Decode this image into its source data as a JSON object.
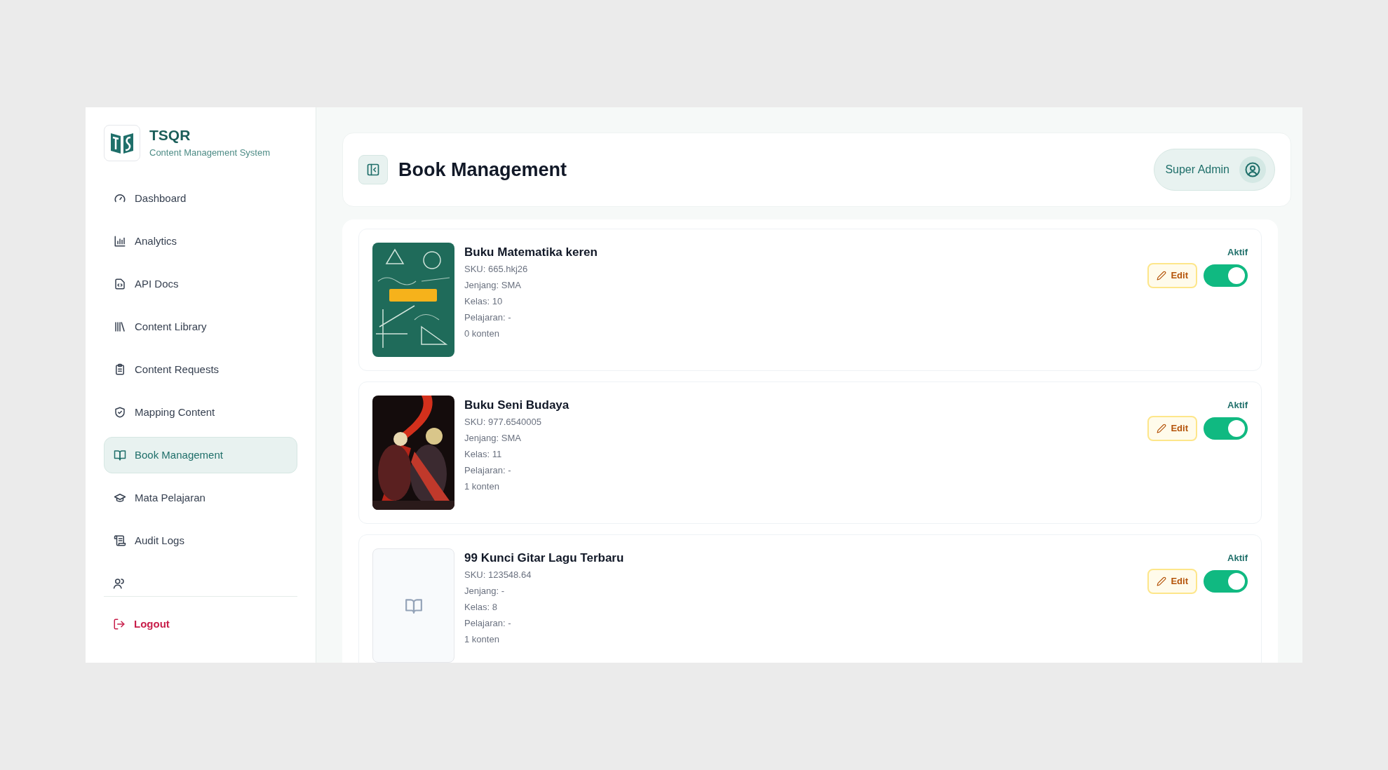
{
  "brand": {
    "name": "TSQR",
    "subtitle": "Content Management System"
  },
  "sidebar": {
    "items": [
      {
        "label": "Dashboard",
        "selected": false
      },
      {
        "label": "Analytics",
        "selected": false
      },
      {
        "label": "API Docs",
        "selected": false
      },
      {
        "label": "Content Library",
        "selected": false
      },
      {
        "label": "Content Requests",
        "selected": false
      },
      {
        "label": "Mapping Content",
        "selected": false
      },
      {
        "label": "Book Management",
        "selected": true
      },
      {
        "label": "Mata Pelajaran",
        "selected": false
      },
      {
        "label": "Audit Logs",
        "selected": false
      }
    ],
    "logout": "Logout"
  },
  "header": {
    "title": "Book Management",
    "user": "Super Admin"
  },
  "books": [
    {
      "title": "Buku Matematika keren",
      "sku": "SKU: 665.hkj26",
      "jenjang": "Jenjang: SMA",
      "kelas": "Kelas: 10",
      "pelajaran": "Pelajaran: -",
      "konten": "0 konten",
      "status": "Aktif",
      "active": true,
      "edit": "Edit"
    },
    {
      "title": "Buku Seni Budaya",
      "sku": "SKU: 977.6540005",
      "jenjang": "Jenjang: SMA",
      "kelas": "Kelas: 11",
      "pelajaran": "Pelajaran: -",
      "konten": "1 konten",
      "status": "Aktif",
      "active": true,
      "edit": "Edit"
    },
    {
      "title": "99 Kunci Gitar Lagu Terbaru",
      "sku": "SKU: 123548.64",
      "jenjang": "Jenjang: -",
      "kelas": "Kelas: 8",
      "pelajaran": "Pelajaran: -",
      "konten": "1 konten",
      "status": "Aktif",
      "active": true,
      "edit": "Edit"
    }
  ]
}
